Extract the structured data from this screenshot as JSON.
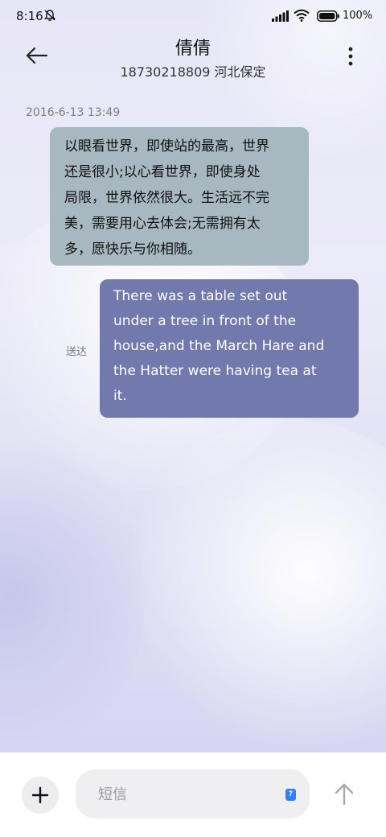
{
  "status_bar": {
    "time": "8:16",
    "battery_text": "100%",
    "icons": [
      "bell-off-icon",
      "signal-icon",
      "wifi-icon",
      "battery-icon"
    ]
  },
  "header": {
    "contact_name": "倩倩",
    "contact_subtitle": "18730218809 河北保定",
    "icons": [
      "back-arrow-icon",
      "more-vertical-icon"
    ]
  },
  "conversation": {
    "timestamp": "2016-6-13 13:49",
    "messages": [
      {
        "direction": "incoming",
        "lines": [
          "以眼看世界，即使站的最高，世界",
          "还是很小;以心看世界，即使身处",
          "局限，世界依然很大。生活远不完",
          "美，需要用心去体会;无需拥有太",
          "多，愿快乐与你相随。"
        ]
      },
      {
        "direction": "outgoing",
        "status": "送达",
        "lines": [
          "There was a table set out",
          "under a tree in front of the",
          "house,and the March Hare and",
          "the Hatter were having tea at",
          "it."
        ]
      }
    ]
  },
  "composer": {
    "placeholder": "短信",
    "value": "",
    "sim_badge": "?",
    "icons": [
      "plus-icon",
      "sim-icon",
      "send-arrow-icon"
    ]
  },
  "colors": {
    "incoming_bubble": "#a7b8c0",
    "outgoing_bubble": "#7179ad",
    "background_tint": "#e7e6f7"
  }
}
